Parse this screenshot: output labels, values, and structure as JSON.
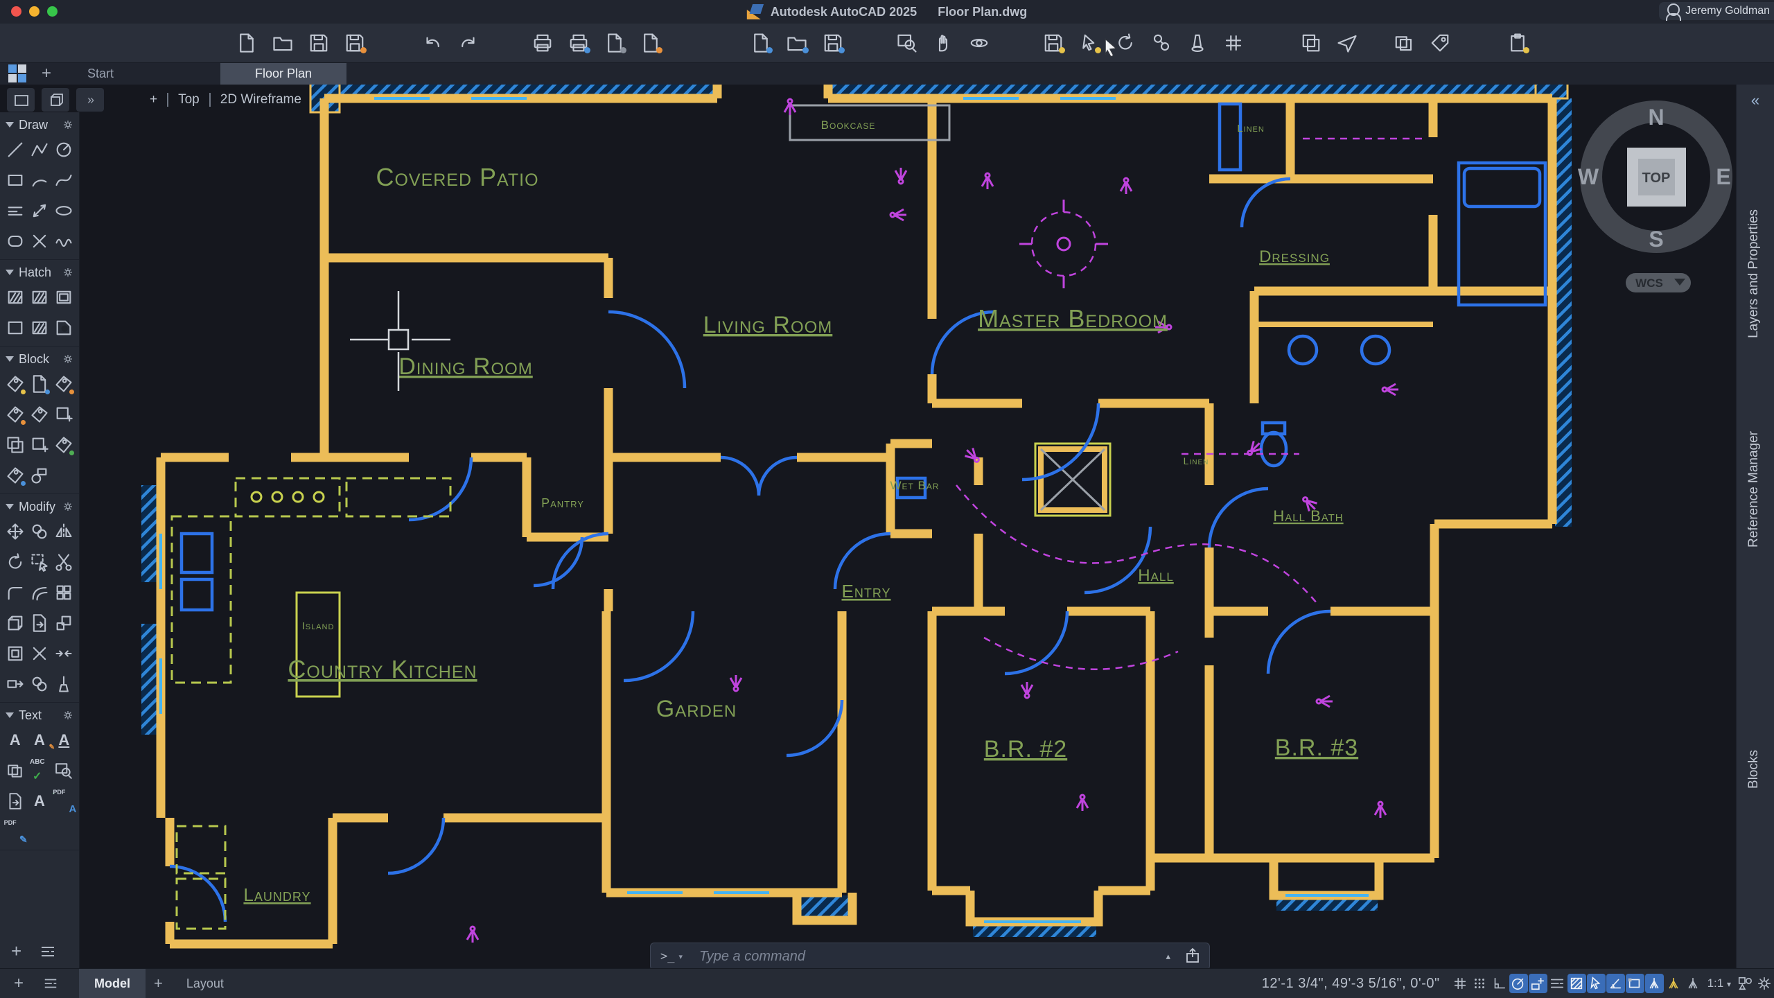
{
  "titlebar": {
    "app_title": "Autodesk AutoCAD 2025",
    "doc_title": "Floor Plan.dwg",
    "user_name": "Jeremy Goldman"
  },
  "toolbar": {
    "icons": [
      "new-file",
      "open",
      "save",
      "save-as",
      "undo",
      "redo",
      "print",
      "print-add",
      "batch-plot",
      "plot-edit",
      "import",
      "export",
      "attach",
      "save-to-web",
      "zoom-window",
      "pan",
      "orbit",
      "tool-save",
      "quick-select",
      "refresh",
      "point-nodes",
      "light",
      "sheet-set",
      "tool-palettes",
      "share-drawing",
      "gallery",
      "tag",
      "paste-clipboard"
    ]
  },
  "file_tabs": {
    "start": "Start",
    "active": "Floor Plan"
  },
  "viewport_controls": {
    "menu": "+",
    "view": "Top",
    "visual_style": "2D Wireframe"
  },
  "tool_panels": {
    "sections": [
      {
        "title": "Draw",
        "icons": [
          "line",
          "polyline",
          "circle",
          "rectangle",
          "arc",
          "spline",
          "multiline",
          "distance",
          "ellipse",
          "rounded-rectangle",
          "point",
          "revision-cloud"
        ]
      },
      {
        "title": "Hatch",
        "icons": [
          "hatch-pattern",
          "hatch-pattern-edit",
          "hatch-solid",
          "hatch-boundary",
          "hatch-texture",
          "hatch-gradient"
        ]
      },
      {
        "title": "Block",
        "icons": [
          "create-block",
          "insert-block",
          "edit-block",
          "block-attribute-edit",
          "block-tag",
          "block-table",
          "block-copy",
          "block-add",
          "block-sync",
          "block-count",
          "block-replace"
        ]
      },
      {
        "title": "Modify",
        "icons": [
          "move",
          "copy",
          "mirror",
          "rotate",
          "select",
          "trim",
          "fillet",
          "offset",
          "array",
          "3d-box",
          "extract",
          "scale",
          "offset-rect",
          "break",
          "join",
          "stretch",
          "align",
          "purge"
        ]
      },
      {
        "title": "Text",
        "icons": [
          "single-line-text",
          "edit-text",
          "underline-text",
          "text-style",
          "spell-check",
          "find-text",
          "import-text",
          "text-arc",
          "pdf-text",
          "pdf-markup"
        ]
      }
    ]
  },
  "viewcube": {
    "north": "N",
    "south": "S",
    "east": "E",
    "west": "W",
    "face": "TOP",
    "ucs": "WCS"
  },
  "right_panel_tabs": [
    {
      "label": "Layers and Properties"
    },
    {
      "label": "Reference Manager"
    },
    {
      "label": "Blocks"
    }
  ],
  "command_line": {
    "prompt": ">_",
    "placeholder": "Type a command"
  },
  "status_bar": {
    "model_tab": "Model",
    "layout_tab": "Layout",
    "coordinates": "12'-1 3/4\",  49'-3 5/16\", 0'-0\"",
    "annotation_scale": "1:1",
    "icons": [
      "grid",
      "snap-mode",
      "ortho-mode",
      "polar-tracking",
      "object-snap",
      "lineweight",
      "hatch-display",
      "selection-cycling",
      "angle-constraint",
      "dynamic-ucs",
      "osnap-tracking",
      "annotation-autoscale",
      "annotation-visibility",
      "annotation-scale",
      "workspace-shapes",
      "customization-gear"
    ]
  },
  "plan": {
    "labels": [
      {
        "text": "Covered Patio"
      },
      {
        "text": "Dining Room"
      },
      {
        "text": "Living Room"
      },
      {
        "text": "Master Bedroom"
      },
      {
        "text": "Bookcase"
      },
      {
        "text": "Linen"
      },
      {
        "text": "Dressing"
      },
      {
        "text": "Wet Bar"
      },
      {
        "text": "Linen"
      },
      {
        "text": "Hall Bath"
      },
      {
        "text": "Hall"
      },
      {
        "text": "Entry"
      },
      {
        "text": "Pantry"
      },
      {
        "text": "Island"
      },
      {
        "text": "Country Kitchen"
      },
      {
        "text": "Garden"
      },
      {
        "text": "B.R. #2"
      },
      {
        "text": "B.R. #3"
      },
      {
        "text": "Laundry"
      }
    ]
  }
}
